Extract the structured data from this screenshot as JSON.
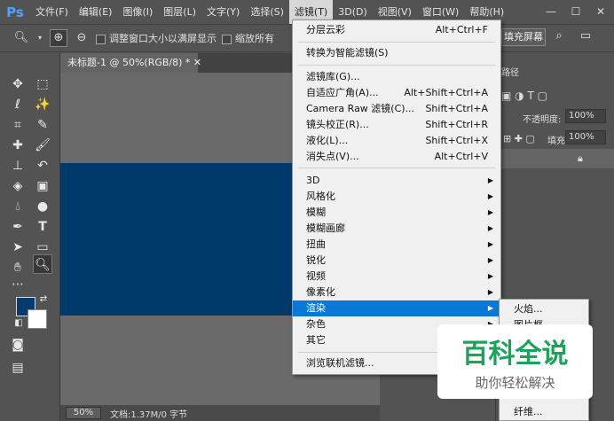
{
  "app": {
    "logo": "Ps"
  },
  "menubar": {
    "items": [
      "文件(F)",
      "编辑(E)",
      "图像(I)",
      "图层(L)",
      "文字(Y)",
      "选择(S)",
      "滤镜(T)",
      "3D(D)",
      "视图(V)",
      "窗口(W)",
      "帮助(H)"
    ],
    "active": "滤镜(T)"
  },
  "options": {
    "resize_windows": "调整窗口大小以满屏显示",
    "zoom_all": "缩放所有",
    "fill_screen": "填充屏幕"
  },
  "document": {
    "tab_title": "未标题-1 @ 50%(RGB/8) *",
    "canvas_color": "#00396b",
    "zoom": "50%",
    "doc_info": "文档:1.37M/0 字节"
  },
  "right_panel": {
    "tab": "路径",
    "opacity_label": "不透明度:",
    "opacity_value": "100%",
    "fill_label": "填充:",
    "fill_value": "100%"
  },
  "filter_menu": {
    "items": [
      {
        "label": "分层云彩",
        "shortcut": "Alt+Ctrl+F"
      },
      {
        "label": "转换为智能滤镜(S)",
        "shortcut": ""
      },
      {
        "label": "滤镜库(G)...",
        "shortcut": ""
      },
      {
        "label": "自适应广角(A)...",
        "shortcut": "Alt+Shift+Ctrl+A"
      },
      {
        "label": "Camera Raw 滤镜(C)...",
        "shortcut": "Shift+Ctrl+A"
      },
      {
        "label": "镜头校正(R)...",
        "shortcut": "Shift+Ctrl+R"
      },
      {
        "label": "液化(L)...",
        "shortcut": "Shift+Ctrl+X"
      },
      {
        "label": "消失点(V)...",
        "shortcut": "Alt+Ctrl+V"
      },
      {
        "label": "3D",
        "shortcut": ""
      },
      {
        "label": "风格化",
        "shortcut": ""
      },
      {
        "label": "模糊",
        "shortcut": ""
      },
      {
        "label": "模糊画廊",
        "shortcut": ""
      },
      {
        "label": "扭曲",
        "shortcut": ""
      },
      {
        "label": "锐化",
        "shortcut": ""
      },
      {
        "label": "视频",
        "shortcut": ""
      },
      {
        "label": "像素化",
        "shortcut": ""
      },
      {
        "label": "渲染",
        "shortcut": ""
      },
      {
        "label": "杂色",
        "shortcut": ""
      },
      {
        "label": "其它",
        "shortcut": ""
      },
      {
        "label": "浏览联机滤镜...",
        "shortcut": ""
      }
    ],
    "highlighted": "渲染"
  },
  "render_submenu": {
    "items": [
      "火焰...",
      "图片框...",
      "纤维..."
    ]
  },
  "watermark": {
    "title": "百科全说",
    "subtitle": "助你轻松解决"
  },
  "colors": {
    "foreground": "#073b6e",
    "background": "#ffffff",
    "highlight": "#0a78d7"
  }
}
